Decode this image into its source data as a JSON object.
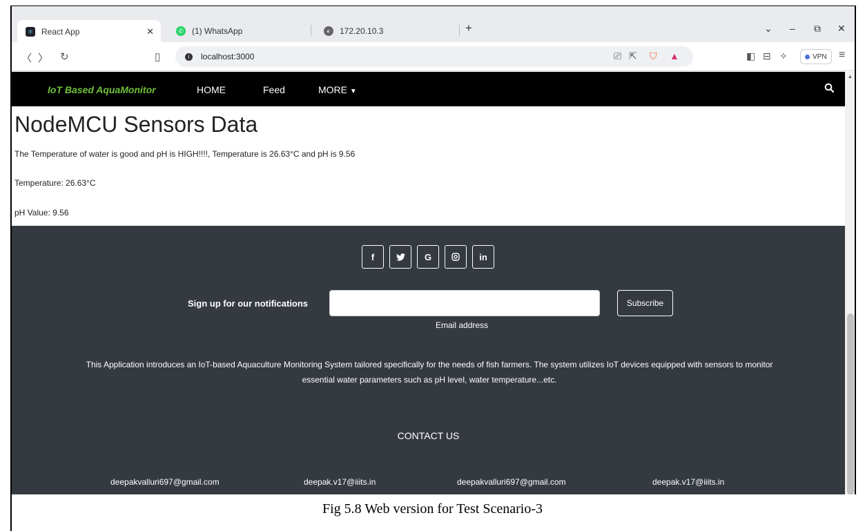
{
  "browser": {
    "tabs": [
      {
        "label": "React App"
      },
      {
        "label": "(1) WhatsApp"
      },
      {
        "label": "172.20.10.3"
      }
    ],
    "new_tab": "+",
    "url": "localhost:3000",
    "vpn_label": "VPN"
  },
  "navbar": {
    "brand": "IoT Based AquaMonitor",
    "links": [
      "HOME",
      "Feed",
      "MORE"
    ],
    "accent_color": "#6fc23a"
  },
  "main": {
    "title": "NodeMCU Sensors Data",
    "status_message": "The Temperature of water is good and pH is HIGH!!!!, Temperature is 26.63°C and pH is 9.56",
    "temperature": "Temperature: 26.63°C",
    "ph": "pH Value: 9.56"
  },
  "footer": {
    "social": [
      "f",
      "G",
      "in"
    ],
    "signup_label": "Sign up for our notifications",
    "email_caption": "Email address",
    "subscribe_label": "Subscribe",
    "description": "This Application introduces an IoT-based Aquaculture Monitoring System tailored specifically for the needs of fish farmers. The system utilizes IoT devices equipped with sensors to monitor essential water parameters such as pH level, water temperature...etc.",
    "contact_title": "CONTACT US",
    "contacts": [
      "deepakvalluri697@gmail.com",
      "deepak.v17@iiits.in",
      "deepakvalluri697@gmail.com",
      "deepak.v17@iiits.in"
    ],
    "bg_color": "#343a40"
  },
  "caption": "Fig 5.8 Web version for Test Scenario-3"
}
